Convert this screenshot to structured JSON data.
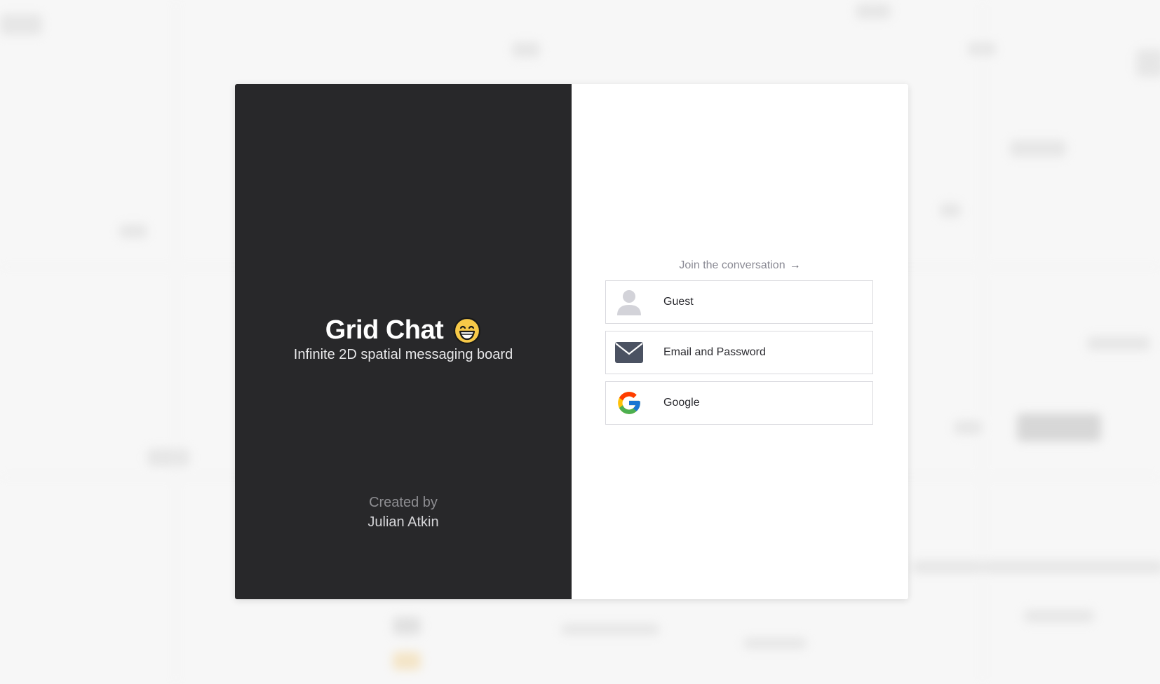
{
  "app": {
    "title": "Grid Chat",
    "subtitle": "Infinite 2D spatial messaging board",
    "created_by_label": "Created by",
    "author": "Julian Atkin",
    "title_emoji_icon": "grinning-face-icon"
  },
  "login": {
    "prompt": "Join the conversation",
    "prompt_arrow": "→",
    "options": [
      {
        "label": "Guest",
        "icon": "user-icon"
      },
      {
        "label": "Email and Password",
        "icon": "envelope-icon"
      },
      {
        "label": "Google",
        "icon": "google-icon"
      }
    ]
  },
  "colors": {
    "left_panel": "#28282a",
    "right_panel": "#ffffff",
    "button_border": "#d9d9de",
    "prompt_text": "#8a8a94"
  }
}
